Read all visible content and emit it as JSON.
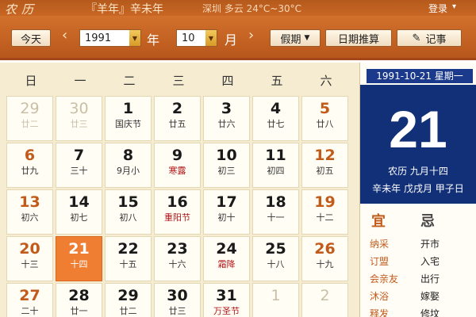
{
  "topbar": {
    "title": "农历",
    "year_name": "『羊年』辛未年",
    "weather": "深圳 多云 24°C~30°C",
    "login": "登录"
  },
  "toolbar": {
    "today": "今天",
    "prev": "‹",
    "year_value": "1991",
    "year_label": "年",
    "month_value": "10",
    "month_label": "月",
    "next": "›",
    "holiday": "假期",
    "date_calc": "日期推算",
    "notes": "记事"
  },
  "weekdays": [
    "日",
    "一",
    "二",
    "三",
    "四",
    "五",
    "六"
  ],
  "weeks": [
    [
      {
        "d": "29",
        "l": "廿二",
        "other": true
      },
      {
        "d": "30",
        "l": "廿三",
        "other": true
      },
      {
        "d": "1",
        "l": "国庆节"
      },
      {
        "d": "2",
        "l": "廿五"
      },
      {
        "d": "3",
        "l": "廿六"
      },
      {
        "d": "4",
        "l": "廿七"
      },
      {
        "d": "5",
        "l": "廿八"
      }
    ],
    [
      {
        "d": "6",
        "l": "廿九"
      },
      {
        "d": "7",
        "l": "三十"
      },
      {
        "d": "8",
        "l": "9月小"
      },
      {
        "d": "9",
        "l": "寒露",
        "festival": true
      },
      {
        "d": "10",
        "l": "初三"
      },
      {
        "d": "11",
        "l": "初四"
      },
      {
        "d": "12",
        "l": "初五"
      }
    ],
    [
      {
        "d": "13",
        "l": "初六"
      },
      {
        "d": "14",
        "l": "初七"
      },
      {
        "d": "15",
        "l": "初八"
      },
      {
        "d": "16",
        "l": "重阳节",
        "festival": true
      },
      {
        "d": "17",
        "l": "初十"
      },
      {
        "d": "18",
        "l": "十一"
      },
      {
        "d": "19",
        "l": "十二"
      }
    ],
    [
      {
        "d": "20",
        "l": "十三"
      },
      {
        "d": "21",
        "l": "十四",
        "today": true
      },
      {
        "d": "22",
        "l": "十五"
      },
      {
        "d": "23",
        "l": "十六"
      },
      {
        "d": "24",
        "l": "霜降",
        "festival": true
      },
      {
        "d": "25",
        "l": "十八"
      },
      {
        "d": "26",
        "l": "十九"
      }
    ],
    [
      {
        "d": "27",
        "l": "二十"
      },
      {
        "d": "28",
        "l": "廿一"
      },
      {
        "d": "29",
        "l": "廿二"
      },
      {
        "d": "30",
        "l": "廿三"
      },
      {
        "d": "31",
        "l": "万圣节",
        "festival": true
      },
      {
        "d": "1",
        "l": "",
        "other": true
      },
      {
        "d": "2",
        "l": "",
        "other": true
      }
    ]
  ],
  "detail": {
    "date_header": "1991-10-21 星期一",
    "day": "21",
    "lunar": "农历 九月十四",
    "ganzhi": "辛未年 戊戌月 甲子日",
    "yi_label": "宜",
    "ji_label": "忌",
    "yi": [
      "纳采",
      "订盟",
      "会亲友",
      "沐浴",
      "释发"
    ],
    "ji": [
      "开市",
      "入宅",
      "出行",
      "嫁娶",
      "修坟"
    ]
  },
  "colors": {
    "header_bg": "#c86624",
    "today_cell": "#ef7e32",
    "detail_bg": "#123078",
    "weekend_text": "#c25a1a",
    "festival_text": "#b0161a"
  }
}
